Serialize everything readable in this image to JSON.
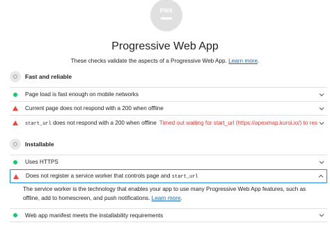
{
  "badge": {
    "text": "PWA"
  },
  "title": "Progressive Web App",
  "description": {
    "text": "These checks validate the aspects of a Progressive Web App.",
    "link": "Learn more"
  },
  "groups": [
    {
      "title": "Fast and reliable",
      "audits": [
        {
          "status": "pass",
          "text": "Page load is fast enough on mobile networks"
        },
        {
          "status": "fail",
          "text": "Current page does not respond with a 200 when offline"
        },
        {
          "status": "fail",
          "code": "start_url",
          "text": " does not respond with a 200 when offline",
          "warning": "Timed out waiting for start_url (https://apexmap.kuroi.io/) to respond."
        }
      ]
    },
    {
      "title": "Installable",
      "audits": [
        {
          "status": "pass",
          "text": "Uses HTTPS"
        },
        {
          "status": "fail",
          "text": "Does not register a service worker that controls page and ",
          "code": "start_url",
          "expanded": true,
          "details": "The service worker is the technology that enables your app to use many Progressive Web App features, such as offline, add to homescreen, and push notifications.",
          "details_link": "Learn more"
        },
        {
          "status": "pass",
          "text": "Web app manifest meets the installability requirements"
        }
      ]
    }
  ],
  "colors": {
    "pass": "#0cce6b",
    "fail": "#f44336",
    "link": "#1565c0",
    "focus": "#1e88e5"
  }
}
